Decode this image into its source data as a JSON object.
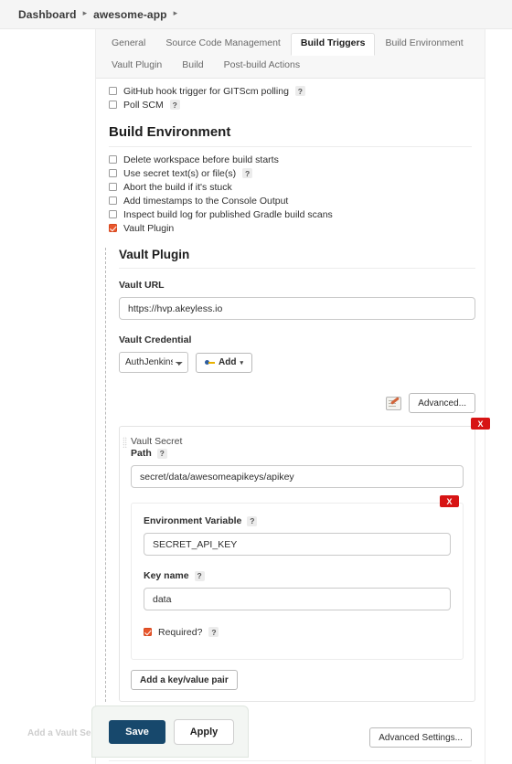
{
  "breadcrumb": {
    "items": [
      {
        "label": "Dashboard"
      },
      {
        "label": "awesome-app"
      }
    ],
    "separator": "▸"
  },
  "tabs": {
    "row1": [
      {
        "label": "General",
        "active": false
      },
      {
        "label": "Source Code Management",
        "active": false
      },
      {
        "label": "Build Triggers",
        "active": true
      },
      {
        "label": "Build Environment",
        "active": false
      }
    ],
    "row2": [
      {
        "label": "Vault Plugin",
        "active": false
      },
      {
        "label": "Build",
        "active": false
      },
      {
        "label": "Post-build Actions",
        "active": false
      }
    ]
  },
  "build_triggers": {
    "options": [
      {
        "label": "GitHub hook trigger for GITScm polling",
        "checked": false,
        "help": "?"
      },
      {
        "label": "Poll SCM",
        "checked": false,
        "help": "?"
      }
    ]
  },
  "build_environment": {
    "heading": "Build Environment",
    "options": [
      {
        "label": "Delete workspace before build starts",
        "checked": false,
        "help": ""
      },
      {
        "label": "Use secret text(s) or file(s)",
        "checked": false,
        "help": "?"
      },
      {
        "label": "Abort the build if it's stuck",
        "checked": false,
        "help": ""
      },
      {
        "label": "Add timestamps to the Console Output",
        "checked": false,
        "help": ""
      },
      {
        "label": "Inspect build log for published Gradle build scans",
        "checked": false,
        "help": ""
      },
      {
        "label": "Vault Plugin",
        "checked": true,
        "help": ""
      }
    ]
  },
  "vault_plugin": {
    "title": "Vault Plugin",
    "url_label": "Vault URL",
    "url_value": "https://hvp.akeyless.io",
    "credential_label": "Vault Credential",
    "credential_selected": "AuthJenkins",
    "credential_options": [
      "AuthJenkins"
    ],
    "add_button": "Add",
    "add_caret": "▾",
    "advanced_button": "Advanced...",
    "advanced_settings_button": "Advanced Settings..."
  },
  "vault_secret": {
    "title": "Vault Secret",
    "delete_label": "X",
    "path_label": "Path",
    "path_help": "?",
    "path_value": "secret/data/awesomeapikeys/apikey",
    "key_value_pair": {
      "delete_label": "X",
      "env_var_label": "Environment Variable",
      "env_var_help": "?",
      "env_var_value": "SECRET_API_KEY",
      "key_name_label": "Key name",
      "key_name_help": "?",
      "key_name_value": "data",
      "required_label": "Required?",
      "required_help": "?",
      "required_checked": true
    },
    "add_kv_button": "Add a key/value pair",
    "add_secret_button": "Add a Vault Secret"
  },
  "footer": {
    "save_label": "Save",
    "apply_label": "Apply"
  },
  "colors": {
    "accent_checkbox": "#e8562c",
    "delete_red": "#d71414",
    "save_navy": "#17486c",
    "breadcrumb_bg": "#f5f5f5"
  }
}
